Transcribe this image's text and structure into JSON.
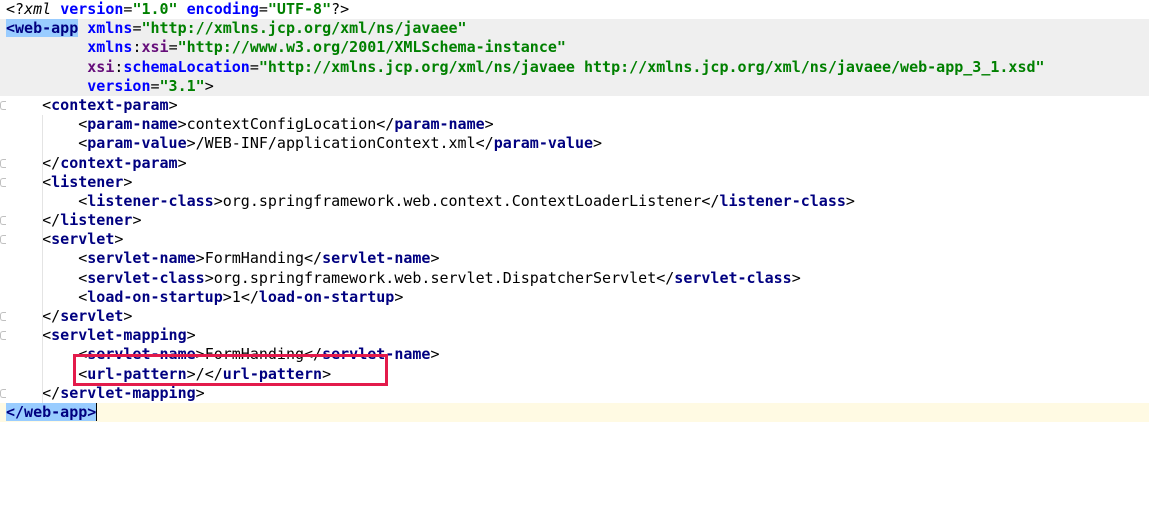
{
  "editor": {
    "language": "xml",
    "colors": {
      "tag": "#000080",
      "attribute": "#0000ff",
      "namespace_prefix": "#660e7a",
      "attribute_value": "#008000",
      "root_tag_highlight": "#99ccff",
      "current_line": "#fffae3",
      "annotation_box": "#e31b4b"
    },
    "lines": [
      {
        "indent": 0,
        "shade": false,
        "mark": false,
        "tokens": [
          {
            "t": "<?",
            "c": "punct"
          },
          {
            "t": "xml",
            "c": "pi"
          },
          {
            "t": " ",
            "c": "text"
          },
          {
            "t": "version",
            "c": "attr"
          },
          {
            "t": "=",
            "c": "punct"
          },
          {
            "t": "\"1.0\"",
            "c": "val"
          },
          {
            "t": " ",
            "c": "text"
          },
          {
            "t": "encoding",
            "c": "attr"
          },
          {
            "t": "=",
            "c": "punct"
          },
          {
            "t": "\"UTF-8\"",
            "c": "val"
          },
          {
            "t": "?>",
            "c": "punct"
          }
        ]
      },
      {
        "indent": 0,
        "shade": true,
        "mark": false,
        "tokens": [
          {
            "t": "<web-app",
            "c": "tag match-hl"
          },
          {
            "t": " ",
            "c": "text"
          },
          {
            "t": "xmlns",
            "c": "attr"
          },
          {
            "t": "=",
            "c": "punct"
          },
          {
            "t": "\"http://xmlns.jcp.org/xml/ns/javaee\"",
            "c": "val"
          }
        ]
      },
      {
        "indent": 9,
        "shade": true,
        "mark": false,
        "tokens": [
          {
            "t": "xmlns",
            "c": "attr"
          },
          {
            "t": ":",
            "c": "punct"
          },
          {
            "t": "xsi",
            "c": "ns"
          },
          {
            "t": "=",
            "c": "punct"
          },
          {
            "t": "\"http://www.w3.org/2001/XMLSchema-instance\"",
            "c": "val"
          }
        ]
      },
      {
        "indent": 9,
        "shade": true,
        "mark": false,
        "tokens": [
          {
            "t": "xsi",
            "c": "ns"
          },
          {
            "t": ":",
            "c": "punct"
          },
          {
            "t": "schemaLocation",
            "c": "attr"
          },
          {
            "t": "=",
            "c": "punct"
          },
          {
            "t": "\"http://xmlns.jcp.org/xml/ns/javaee http://xmlns.jcp.org/xml/ns/javaee/web-app_3_1.xsd\"",
            "c": "val"
          }
        ]
      },
      {
        "indent": 9,
        "shade": true,
        "mark": false,
        "tokens": [
          {
            "t": "version",
            "c": "attr"
          },
          {
            "t": "=",
            "c": "punct"
          },
          {
            "t": "\"3.1\"",
            "c": "val"
          },
          {
            "t": ">",
            "c": "punct"
          }
        ]
      },
      {
        "indent": 4,
        "shade": false,
        "mark": true,
        "tokens": [
          {
            "t": "<",
            "c": "punct"
          },
          {
            "t": "context-param",
            "c": "tag"
          },
          {
            "t": ">",
            "c": "punct"
          }
        ]
      },
      {
        "indent": 8,
        "shade": false,
        "mark": false,
        "tokens": [
          {
            "t": "<",
            "c": "punct"
          },
          {
            "t": "param-name",
            "c": "tag"
          },
          {
            "t": ">",
            "c": "punct"
          },
          {
            "t": "contextConfigLocation",
            "c": "text"
          },
          {
            "t": "</",
            "c": "punct"
          },
          {
            "t": "param-name",
            "c": "tag"
          },
          {
            "t": ">",
            "c": "punct"
          }
        ]
      },
      {
        "indent": 8,
        "shade": false,
        "mark": false,
        "tokens": [
          {
            "t": "<",
            "c": "punct"
          },
          {
            "t": "param-value",
            "c": "tag"
          },
          {
            "t": ">",
            "c": "punct"
          },
          {
            "t": "/WEB-INF/applicationContext.xml",
            "c": "text"
          },
          {
            "t": "</",
            "c": "punct"
          },
          {
            "t": "param-value",
            "c": "tag"
          },
          {
            "t": ">",
            "c": "punct"
          }
        ]
      },
      {
        "indent": 4,
        "shade": false,
        "mark": true,
        "tokens": [
          {
            "t": "</",
            "c": "punct"
          },
          {
            "t": "context-param",
            "c": "tag"
          },
          {
            "t": ">",
            "c": "punct"
          }
        ]
      },
      {
        "indent": 4,
        "shade": false,
        "mark": true,
        "tokens": [
          {
            "t": "<",
            "c": "punct"
          },
          {
            "t": "listener",
            "c": "tag"
          },
          {
            "t": ">",
            "c": "punct"
          }
        ]
      },
      {
        "indent": 8,
        "shade": false,
        "mark": false,
        "tokens": [
          {
            "t": "<",
            "c": "punct"
          },
          {
            "t": "listener-class",
            "c": "tag"
          },
          {
            "t": ">",
            "c": "punct"
          },
          {
            "t": "org.springframework.web.context.ContextLoaderListener",
            "c": "text"
          },
          {
            "t": "</",
            "c": "punct"
          },
          {
            "t": "listener-class",
            "c": "tag"
          },
          {
            "t": ">",
            "c": "punct"
          }
        ]
      },
      {
        "indent": 4,
        "shade": false,
        "mark": true,
        "tokens": [
          {
            "t": "</",
            "c": "punct"
          },
          {
            "t": "listener",
            "c": "tag"
          },
          {
            "t": ">",
            "c": "punct"
          }
        ]
      },
      {
        "indent": 4,
        "shade": false,
        "mark": true,
        "tokens": [
          {
            "t": "<",
            "c": "punct"
          },
          {
            "t": "servlet",
            "c": "tag"
          },
          {
            "t": ">",
            "c": "punct"
          }
        ]
      },
      {
        "indent": 8,
        "shade": false,
        "mark": false,
        "tokens": [
          {
            "t": "<",
            "c": "punct"
          },
          {
            "t": "servlet-name",
            "c": "tag"
          },
          {
            "t": ">",
            "c": "punct"
          },
          {
            "t": "FormHanding",
            "c": "text"
          },
          {
            "t": "</",
            "c": "punct"
          },
          {
            "t": "servlet-name",
            "c": "tag"
          },
          {
            "t": ">",
            "c": "punct"
          }
        ]
      },
      {
        "indent": 8,
        "shade": false,
        "mark": false,
        "tokens": [
          {
            "t": "<",
            "c": "punct"
          },
          {
            "t": "servlet-class",
            "c": "tag"
          },
          {
            "t": ">",
            "c": "punct"
          },
          {
            "t": "org.springframework.web.servlet.DispatcherServlet",
            "c": "text"
          },
          {
            "t": "</",
            "c": "punct"
          },
          {
            "t": "servlet-class",
            "c": "tag"
          },
          {
            "t": ">",
            "c": "punct"
          }
        ]
      },
      {
        "indent": 8,
        "shade": false,
        "mark": false,
        "tokens": [
          {
            "t": "<",
            "c": "punct"
          },
          {
            "t": "load-on-startup",
            "c": "tag"
          },
          {
            "t": ">",
            "c": "punct"
          },
          {
            "t": "1",
            "c": "text"
          },
          {
            "t": "</",
            "c": "punct"
          },
          {
            "t": "load-on-startup",
            "c": "tag"
          },
          {
            "t": ">",
            "c": "punct"
          }
        ]
      },
      {
        "indent": 4,
        "shade": false,
        "mark": true,
        "tokens": [
          {
            "t": "</",
            "c": "punct"
          },
          {
            "t": "servlet",
            "c": "tag"
          },
          {
            "t": ">",
            "c": "punct"
          }
        ]
      },
      {
        "indent": 4,
        "shade": false,
        "mark": true,
        "tokens": [
          {
            "t": "<",
            "c": "punct"
          },
          {
            "t": "servlet-mapping",
            "c": "tag"
          },
          {
            "t": ">",
            "c": "punct"
          }
        ]
      },
      {
        "indent": 8,
        "shade": false,
        "mark": false,
        "tokens": [
          {
            "t": "<",
            "c": "punct"
          },
          {
            "t": "servlet-name",
            "c": "tag"
          },
          {
            "t": ">",
            "c": "punct"
          },
          {
            "t": "FormHanding",
            "c": "text"
          },
          {
            "t": "</",
            "c": "punct"
          },
          {
            "t": "servlet-name",
            "c": "tag"
          },
          {
            "t": ">",
            "c": "punct"
          }
        ]
      },
      {
        "indent": 8,
        "shade": false,
        "mark": false,
        "tokens": [
          {
            "t": "<",
            "c": "punct"
          },
          {
            "t": "url-pattern",
            "c": "tag"
          },
          {
            "t": ">",
            "c": "punct"
          },
          {
            "t": "/",
            "c": "text"
          },
          {
            "t": "</",
            "c": "punct"
          },
          {
            "t": "url-pattern",
            "c": "tag"
          },
          {
            "t": ">",
            "c": "punct"
          }
        ]
      },
      {
        "indent": 4,
        "shade": false,
        "mark": true,
        "tokens": [
          {
            "t": "</",
            "c": "punct"
          },
          {
            "t": "servlet-mapping",
            "c": "tag"
          },
          {
            "t": ">",
            "c": "punct"
          }
        ]
      },
      {
        "indent": 0,
        "shade": false,
        "current": true,
        "mark": false,
        "tokens": [
          {
            "t": "</web-app>",
            "c": "tag match-hl caret"
          }
        ]
      }
    ]
  }
}
